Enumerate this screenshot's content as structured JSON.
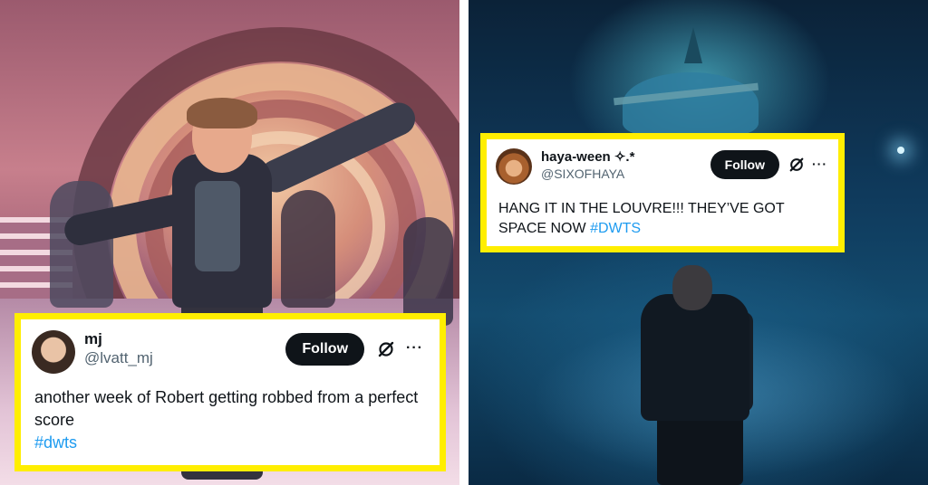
{
  "tweets": {
    "mj": {
      "name": "mj",
      "handle": "@lvatt_mj",
      "follow_label": "Follow",
      "text": "another week of Robert getting robbed from a perfect score",
      "hashtag": "#dwts"
    },
    "haya": {
      "name": "haya-ween ✧.*",
      "handle": "@SIXOFHAYA",
      "follow_label": "Follow",
      "text": "HANG IT IN THE LOUVRE!!! THEY’VE GOT SPACE NOW",
      "hashtag": "#DWTS"
    }
  },
  "colors": {
    "card_border": "#ffee00",
    "follow_button": "#0f1419",
    "hashtag": "#1d9bf0",
    "handle": "#536471"
  },
  "icons": {
    "grok": "grok-icon",
    "more": "more-icon",
    "more_glyph": "···"
  }
}
